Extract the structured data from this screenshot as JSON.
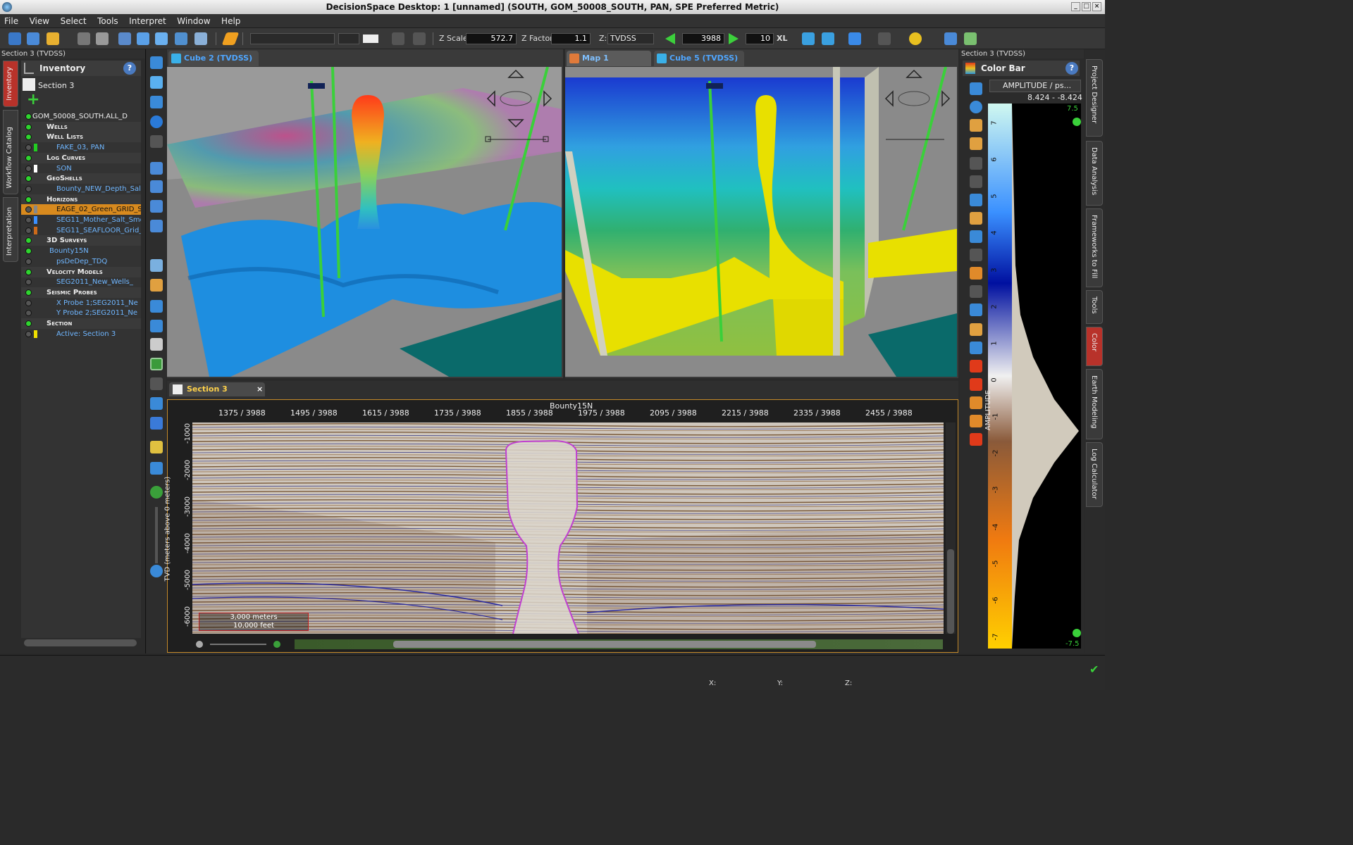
{
  "window": {
    "title": "DecisionSpace Desktop: 1 [unnamed] (SOUTH, GOM_50008_SOUTH, PAN, SPE Preferred Metric)"
  },
  "menu": [
    "File",
    "View",
    "Select",
    "Tools",
    "Interpret",
    "Window",
    "Help"
  ],
  "toolbar": {
    "zscale_label": "Z Scale:",
    "zscale_value": "572.7",
    "zfactor_label": "Z Factor:",
    "zfactor_value": "1.1",
    "z_label": "Z:",
    "z_domain": "TVDSS",
    "inline_value": "3988",
    "step_value": "10",
    "step_unit": "XL"
  },
  "left_panel": {
    "header": "Section 3 (TVDSS)",
    "vtabs": [
      "Inventory",
      "Workflow Catalog",
      "Interpretation"
    ],
    "title": "Inventory",
    "section_label": "Section 3",
    "tree": [
      {
        "text": "GOM_50008_SOUTH.ALL_D",
        "kind": "root"
      },
      {
        "text": "Wells",
        "kind": "cat"
      },
      {
        "text": "Well Lists",
        "kind": "cat"
      },
      {
        "text": "FAKE_03, PAN",
        "kind": "item",
        "color": "#22cc22"
      },
      {
        "text": "Log Curves",
        "kind": "cat"
      },
      {
        "text": "SON",
        "kind": "item",
        "color": "#ffffff"
      },
      {
        "text": "GeoShells",
        "kind": "cat"
      },
      {
        "text": "Bounty_NEW_Depth_Salt_",
        "kind": "item",
        "color": ""
      },
      {
        "text": "Horizons",
        "kind": "cat"
      },
      {
        "text": "EAGE_02_Green_GRID_S",
        "kind": "sel",
        "color": "#888888"
      },
      {
        "text": "SEG11_Mother_Salt_Smo",
        "kind": "item",
        "color": "#3a8fff"
      },
      {
        "text": "SEG11_SEAFLOOR_Grid_",
        "kind": "item",
        "color": "#cc6a1a"
      },
      {
        "text": "3D Surveys",
        "kind": "cat"
      },
      {
        "text": "Bounty15N",
        "kind": "item2"
      },
      {
        "text": "psDeDep_TDQ",
        "kind": "item"
      },
      {
        "text": "Velocity Models",
        "kind": "cat"
      },
      {
        "text": "SEG2011_New_Wells_",
        "kind": "item"
      },
      {
        "text": "Seismic Probes",
        "kind": "cat"
      },
      {
        "text": "X Probe 1;SEG2011_Ne",
        "kind": "item"
      },
      {
        "text": "Y Probe 2;SEG2011_Ne",
        "kind": "item"
      },
      {
        "text": "Section",
        "kind": "cat"
      },
      {
        "text": "Active: Section 3",
        "kind": "item",
        "color": "#f0e000"
      }
    ]
  },
  "views": {
    "cube2_tab": "Cube 2 (TVDSS)",
    "map1_tab": "Map 1 (TVDSS)",
    "cube5_tab": "Cube 5 (TVDSS)"
  },
  "section": {
    "tab": "Section 3 (TVDSS)",
    "survey": "Bounty15N",
    "xticks": [
      "1375 / 3988",
      "1495 / 3988",
      "1615 / 3988",
      "1735 / 3988",
      "1855 / 3988",
      "1975 / 3988",
      "2095 / 3988",
      "2215 / 3988",
      "2335 / 3988",
      "2455 / 3988"
    ],
    "yticks": [
      "-1000",
      "-2000",
      "-3000",
      "-4000",
      "-5000",
      "-6000"
    ],
    "ylabel": "TVD (meters above 0 meters)",
    "scale_m": "3,000 meters",
    "scale_ft": "10,000 feet"
  },
  "color_panel": {
    "header": "Section 3 (TVDSS)",
    "title": "Color Bar",
    "attribute": "AMPLITUDE / ps...",
    "range": "8.424 - -8.424",
    "max_label": "7.5",
    "min_label": "-7.5",
    "ticks": [
      "7",
      "6",
      "5",
      "4",
      "3",
      "2",
      "1",
      "0",
      "-1",
      "-2",
      "-3",
      "-4",
      "-5",
      "-6",
      "-7"
    ],
    "axis_label": "AMPLITUDE"
  },
  "right_tabs": [
    "Project Designer",
    "Data Analysis",
    "Frameworks to Fill",
    "Tools",
    "Color",
    "Earth Modeling",
    "Log Calculator"
  ],
  "status": {
    "x": "X:",
    "y": "Y:",
    "z": "Z:"
  }
}
